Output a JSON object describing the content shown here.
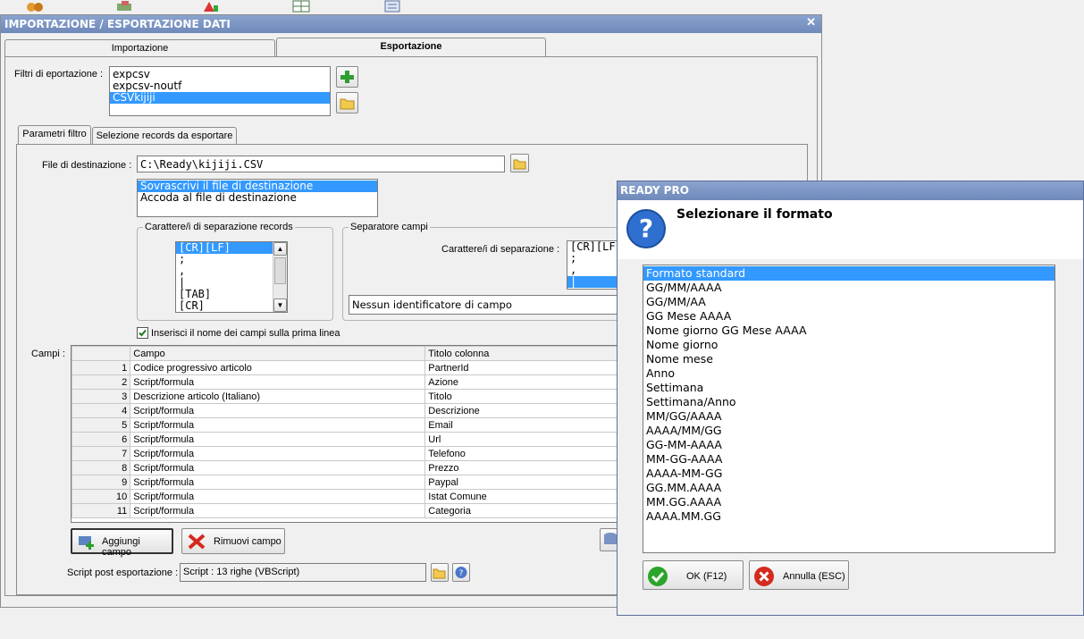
{
  "window": {
    "title": "IMPORTAZIONE / ESPORTAZIONE DATI",
    "close_glyph": "✕"
  },
  "tabs": [
    {
      "label": "Importazione"
    },
    {
      "label": "Esportazione",
      "active": true
    }
  ],
  "filters": {
    "label": "Filtri di eportazione :",
    "items": [
      "expcsv",
      "expcsv-noutf",
      "CSVkijiji"
    ],
    "selected_index": 2
  },
  "subtabs": [
    {
      "label": "Parametri filtro",
      "active": true
    },
    {
      "label": "Selezione records da esportare"
    }
  ],
  "destination": {
    "label": "File di destinazione :",
    "value": "C:\\Ready\\kijiji.CSV",
    "mode_options": [
      "Sovrascrivi il file di destinazione",
      "Accoda al file di destinazione"
    ],
    "mode_selected_index": 0
  },
  "record_separator": {
    "title": "Carattere/i di separazione records",
    "items": [
      "[CR][LF]",
      ";",
      ",",
      "|",
      "[TAB]",
      "[CR]"
    ],
    "selected_index": 0
  },
  "field_separator": {
    "title": "Separatore campi",
    "label": "Carattere/i di separazione :",
    "items": [
      "[CR][LF]",
      ";",
      ",",
      "|"
    ],
    "selected_index": 3,
    "identifier_value": "Nessun identificatore di campo"
  },
  "header_checkbox": {
    "label": "Inserisci il nome dei campi sulla prima linea",
    "checked": true
  },
  "fields": {
    "label": "Campi :",
    "columns": [
      "Campo",
      "Titolo colonna"
    ],
    "rows": [
      {
        "n": "1",
        "campo": "Codice progressivo articolo",
        "titolo": "PartnerId"
      },
      {
        "n": "2",
        "campo": "Script/formula",
        "titolo": "Azione"
      },
      {
        "n": "3",
        "campo": "Descrizione articolo (Italiano)",
        "titolo": "Titolo"
      },
      {
        "n": "4",
        "campo": "Script/formula",
        "titolo": "Descrizione"
      },
      {
        "n": "5",
        "campo": "Script/formula",
        "titolo": "Email"
      },
      {
        "n": "6",
        "campo": "Script/formula",
        "titolo": "Url"
      },
      {
        "n": "7",
        "campo": "Script/formula",
        "titolo": "Telefono"
      },
      {
        "n": "8",
        "campo": "Script/formula",
        "titolo": "Prezzo"
      },
      {
        "n": "9",
        "campo": "Script/formula",
        "titolo": "Paypal"
      },
      {
        "n": "10",
        "campo": "Script/formula",
        "titolo": "Istat Comune"
      },
      {
        "n": "11",
        "campo": "Script/formula",
        "titolo": "Categoria"
      }
    ]
  },
  "buttons": {
    "add_field": "Aggiungi campo",
    "remove_field": "Rimuovi campo"
  },
  "post_script": {
    "label": "Script post esportazione :",
    "value": "Script : 13 righe (VBScript)"
  },
  "dialog": {
    "title": "READY PRO",
    "question": "Selezionare il formato",
    "formats": [
      "Formato standard",
      "GG/MM/AAAA",
      "GG/MM/AA",
      "GG Mese AAAA",
      "Nome giorno GG Mese AAAA",
      "Nome giorno",
      "Nome mese",
      "Anno",
      "Settimana",
      "Settimana/Anno",
      "MM/GG/AAAA",
      "AAAA/MM/GG",
      "GG-MM-AAAA",
      "MM-GG-AAAA",
      "AAAA-MM-GG",
      "GG.MM.AAAA",
      "MM.GG.AAAA",
      "AAAA.MM.GG"
    ],
    "selected_index": 0,
    "ok_label": "OK (F12)",
    "cancel_label": "Annulla (ESC)"
  },
  "colors": {
    "titlebar": "#7b93c2",
    "selection": "#3399ff",
    "ok_green": "#2aa52a",
    "cancel_red": "#d42a1e"
  }
}
